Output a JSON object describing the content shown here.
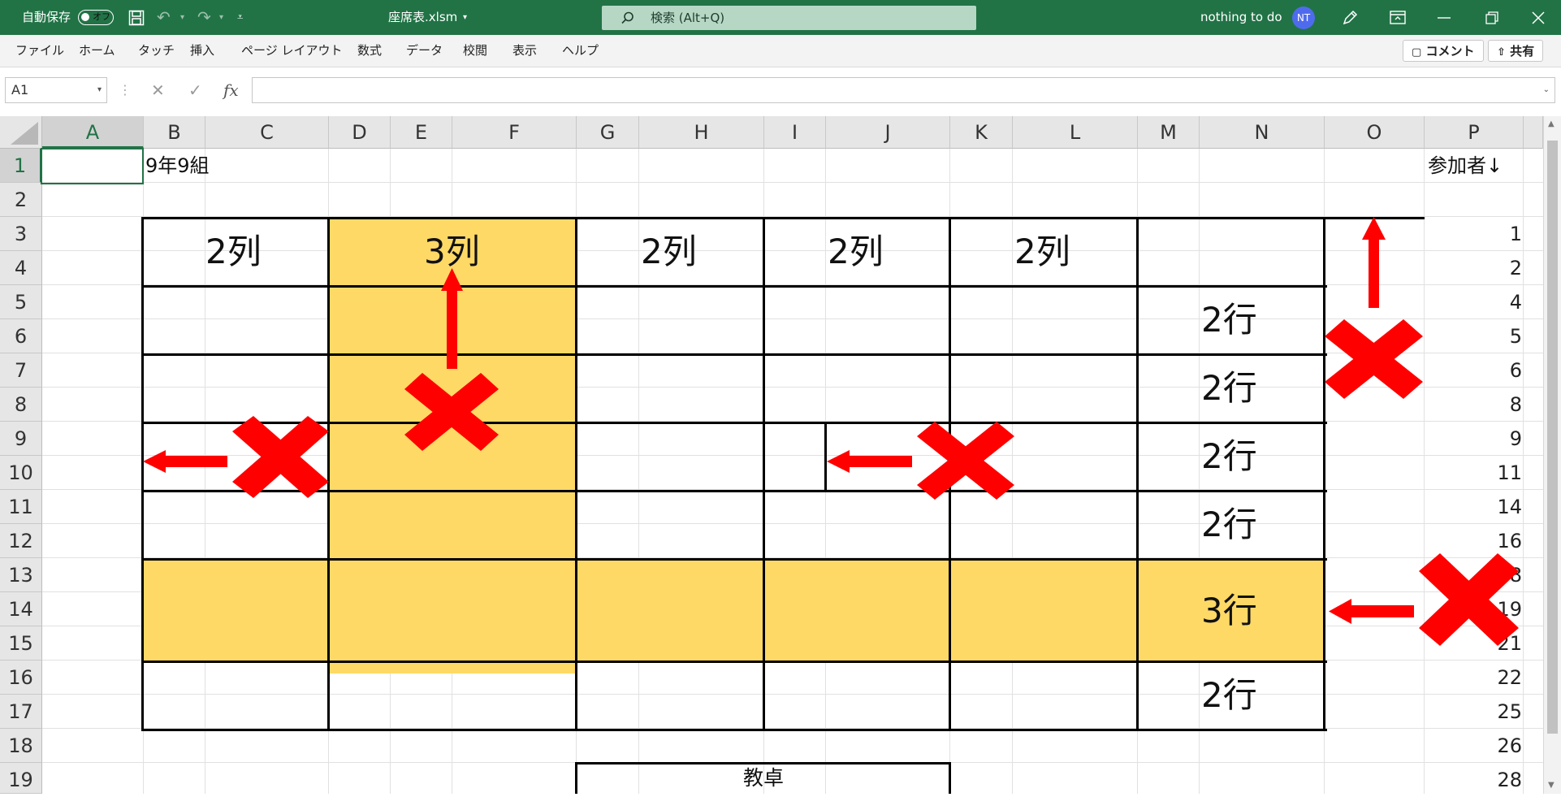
{
  "titlebar": {
    "autosave_label": "自動保存",
    "autosave_state": "オフ",
    "filename": "座席表.xlsm",
    "search_placeholder": "検索 (Alt+Q)",
    "user_name": "nothing to do",
    "user_initials": "NT"
  },
  "ribbon": {
    "tabs": [
      "ファイル",
      "ホーム",
      "タッチ",
      "挿入",
      "ページ レイアウト",
      "数式",
      "データ",
      "校閲",
      "表示",
      "ヘルプ"
    ],
    "comment_label": "コメント",
    "share_label": "共有"
  },
  "formula_bar": {
    "name_box": "A1",
    "fx_label": "fx",
    "formula": ""
  },
  "sheet": {
    "columns": [
      "A",
      "B",
      "C",
      "D",
      "E",
      "F",
      "G",
      "H",
      "I",
      "J",
      "K",
      "L",
      "M",
      "N",
      "O",
      "P"
    ],
    "rows": [
      "1",
      "2",
      "3",
      "4",
      "5",
      "6",
      "7",
      "8",
      "9",
      "10",
      "11",
      "12",
      "13",
      "14",
      "15",
      "16",
      "17",
      "18",
      "19"
    ],
    "cell_b1": "9年9組",
    "cell_p1": "参加者↓",
    "seat_labels": {
      "col_b": "2列",
      "col_d": "3列",
      "col_g": "2列",
      "col_i": "2列",
      "col_k": "2列",
      "row_5": "2行",
      "row_7": "2行",
      "row_9": "2行",
      "row_11": "2行",
      "row_13": "3行",
      "row_16": "2行"
    },
    "teacher_desk": "教卓",
    "participants": [
      "1",
      "2",
      "4",
      "5",
      "6",
      "8",
      "9",
      "11",
      "14",
      "16",
      "18",
      "19",
      "21",
      "22",
      "25",
      "26",
      "28"
    ],
    "highlight_color": "#fed966",
    "annotation_color": "#ff0000"
  }
}
